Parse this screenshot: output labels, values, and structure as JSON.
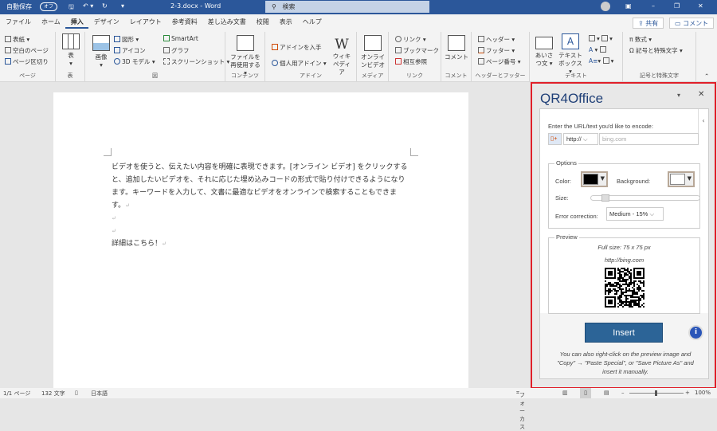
{
  "titlebar": {
    "autosave_label": "自動保存",
    "autosave_state": "オフ",
    "doc_title": "2-3.docx  -  Word",
    "search_placeholder": "検索"
  },
  "tabs": [
    "ファイル",
    "ホーム",
    "挿入",
    "デザイン",
    "レイアウト",
    "参考資料",
    "差し込み文書",
    "校閲",
    "表示",
    "ヘルプ"
  ],
  "share": {
    "share_label": "共有",
    "comment_label": "コメント"
  },
  "ribbon": {
    "page": {
      "items": [
        "表紙",
        "空白のページ",
        "ページ区切り"
      ],
      "label": "ページ"
    },
    "table": {
      "item": "表",
      "label": "表"
    },
    "illust": {
      "image": "画像",
      "items": [
        "図形",
        "アイコン",
        "3D モデル",
        "SmartArt",
        "グラフ",
        "スクリーンショット"
      ],
      "label": "図"
    },
    "content": {
      "item": "ファイルを再使用する",
      "label": "コンテンツ"
    },
    "addin": {
      "items": [
        "アドインを入手",
        "個人用アドイン"
      ],
      "wiki": "ウィキペディア",
      "label": "アドイン"
    },
    "media": {
      "item": "オンラインビデオ",
      "label": "メディア"
    },
    "link": {
      "items": [
        "リンク",
        "ブックマーク",
        "相互参照"
      ],
      "label": "リンク"
    },
    "comment": {
      "item": "コメント",
      "label": "コメント"
    },
    "hf": {
      "items": [
        "ヘッダー",
        "フッター",
        "ページ番号"
      ],
      "label": "ヘッダーとフッター"
    },
    "text": {
      "greeting": "あいさつ文",
      "textbox": "テキストボックス",
      "label": "テキスト"
    },
    "symbols": {
      "items": [
        "数式",
        "記号と特殊文字"
      ],
      "label": "記号と特殊文字"
    }
  },
  "document": {
    "paragraph": "ビデオを使うと、伝えたい内容を明確に表現できます。[オンライン ビデオ] をクリックすると、追加したいビデオを、それに応じた埋め込みコードの形式で貼り付けできるようになります。キーワードを入力して、文書に最適なビデオをオンラインで検索することもできます。",
    "last_line": "詳細はこちら！",
    "para_mark": "↵"
  },
  "pane": {
    "title": "QR4Office",
    "encode_label": "Enter the URL/text you'd like to encode:",
    "protocol": "http://",
    "url_placeholder": "bing.com",
    "options_legend": "Options",
    "color_label": "Color:",
    "background_label": "Background:",
    "size_label": "Size:",
    "size_value": 0.1,
    "error_label": "Error correction:",
    "error_value": "Medium - 15%",
    "preview_legend": "Preview",
    "full_size": "Full size: 75 x 75 px",
    "preview_url": "http://bing.com",
    "insert_label": "Insert",
    "note": "You can also right-click on the preview image and \"Copy\" → \"Paste Special\", or \"Save Picture As\" and insert it manually.",
    "fg_color": "#000000",
    "bg_color": "#ffffff"
  },
  "statusbar": {
    "page": "1/1 ページ",
    "words": "132 文字",
    "language": "日本語",
    "focus": "フォーカス",
    "zoom": "100%",
    "zoom_value": 100
  }
}
